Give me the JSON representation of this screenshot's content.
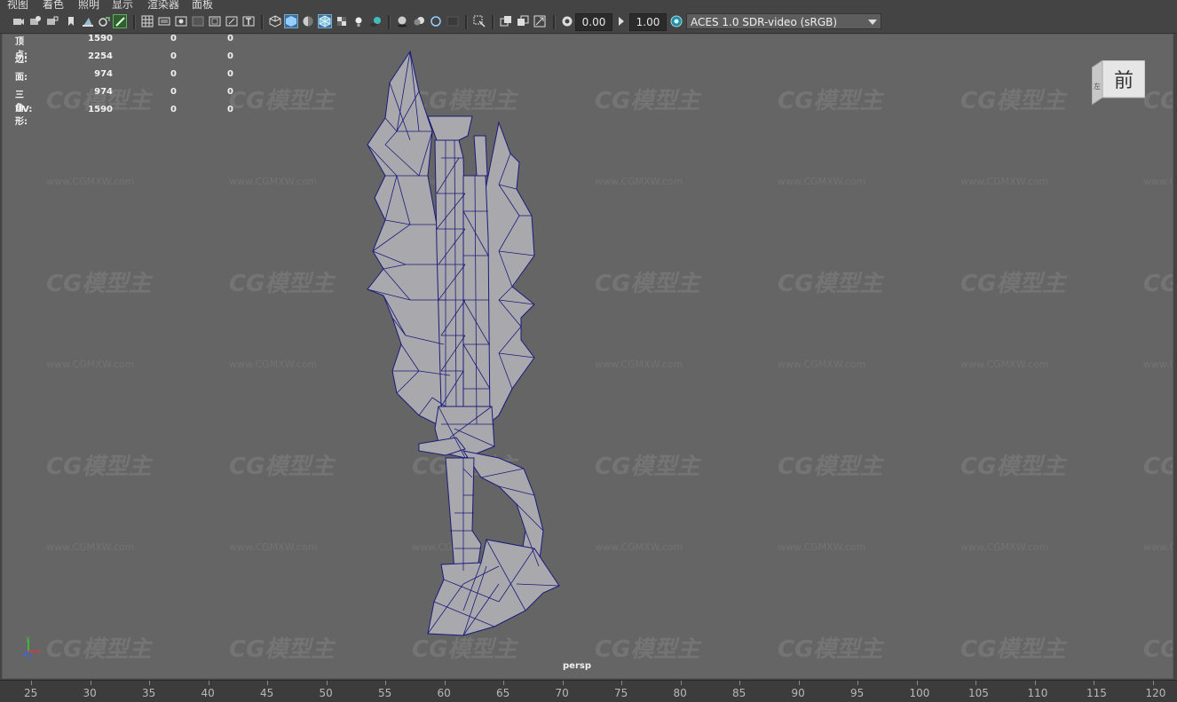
{
  "menubar": {
    "items": [
      "视图",
      "着色",
      "照明",
      "显示",
      "渲染器",
      "面板"
    ]
  },
  "toolbar": {
    "exposure_value": "0.00",
    "gamma_value": "1.00",
    "color_management": "ACES 1.0 SDR-video (sRGB)",
    "icons": [
      "camera-icon",
      "camera-attributes-icon",
      "bookmark-icon",
      "image-plane-icon",
      "grid-icon",
      "film-gate-icon",
      "resolution-gate-icon",
      "gate-mask-icon",
      "field-chart-icon",
      "safe-action-icon",
      "wireframe-icon",
      "smooth-shade-icon",
      "wireframe-on-shaded-icon",
      "textured-icon",
      "lights-icon",
      "shadows-icon",
      "ambient-occlusion-icon",
      "motion-blur-icon",
      "isolate-select-icon",
      "xray-icon",
      "xray-joints-icon",
      "backface-icon",
      "exposure-icon",
      "gamma-icon",
      "color-management-icon"
    ],
    "active_color": "#5b9bd5"
  },
  "hud": {
    "rows": [
      {
        "label": "顶点:",
        "v1": "1590",
        "v2": "0",
        "v3": "0"
      },
      {
        "label": "边:",
        "v1": "2254",
        "v2": "0",
        "v3": "0"
      },
      {
        "label": "面:",
        "v1": "974",
        "v2": "0",
        "v3": "0"
      },
      {
        "label": "三角形:",
        "v1": "974",
        "v2": "0",
        "v3": "0"
      },
      {
        "label": "UV:",
        "v1": "1590",
        "v2": "0",
        "v3": "0"
      }
    ]
  },
  "viewcube": {
    "face_front": "前",
    "face_side": "左"
  },
  "viewport": {
    "camera": "persp",
    "background": "#656565",
    "wire_color": "#1a1a7a",
    "mesh_color": "#a9a9ad"
  },
  "axis": {
    "y": "y",
    "z": "z",
    "x": "x"
  },
  "watermark": {
    "logo": "CG模型主",
    "url": "www.CGMXW.com"
  },
  "timeline": {
    "ticks": [
      "25",
      "30",
      "35",
      "40",
      "45",
      "50",
      "55",
      "60",
      "65",
      "70",
      "75",
      "80",
      "85",
      "90",
      "95",
      "100",
      "105",
      "110",
      "115",
      "120"
    ]
  }
}
